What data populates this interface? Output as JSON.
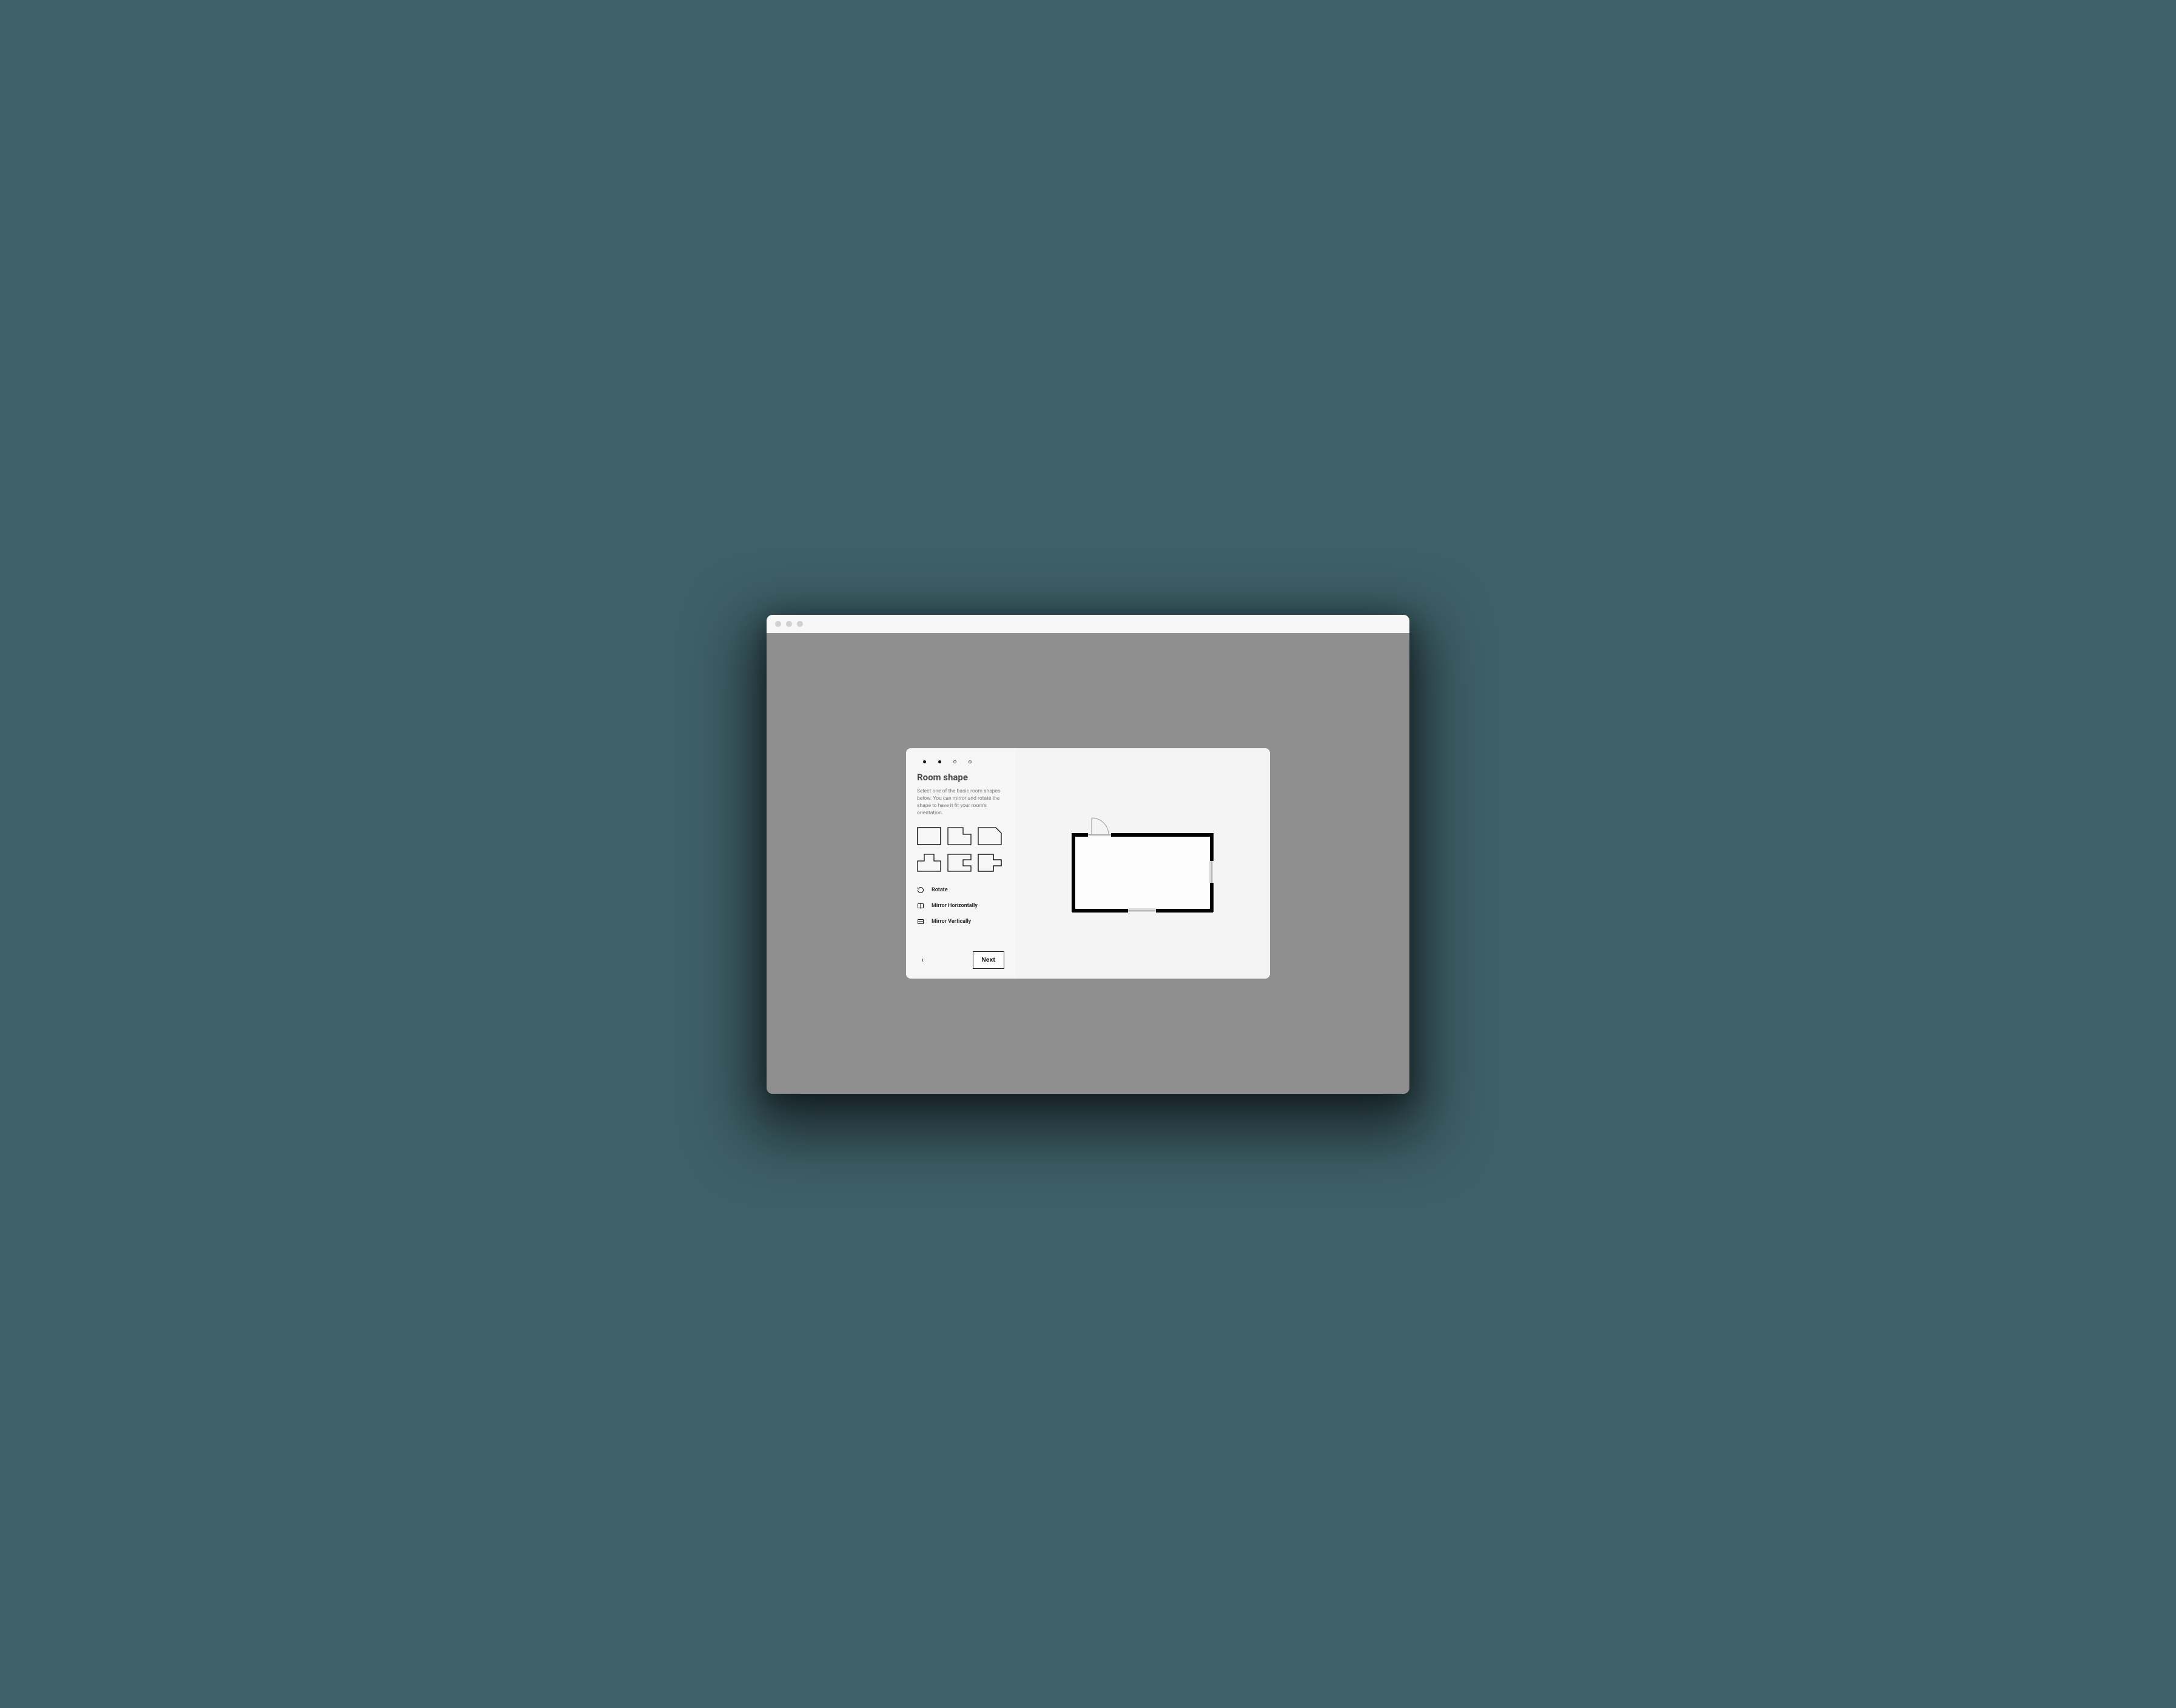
{
  "stepper": {
    "total": 4,
    "current": 2
  },
  "panel": {
    "title": "Room shape",
    "description": "Select one of the basic room shapes below. You can mirror and rotate the shape to have it fit your room's orientation."
  },
  "shapes": [
    {
      "id": "rectangle",
      "selected": true
    },
    {
      "id": "l-shape",
      "selected": false
    },
    {
      "id": "cut-corner",
      "selected": false
    },
    {
      "id": "t-shape",
      "selected": false
    },
    {
      "id": "c-shape",
      "selected": false
    },
    {
      "id": "cross-shape",
      "selected": false
    }
  ],
  "actions": {
    "rotate": "Rotate",
    "mirror_h": "Mirror Horizontally",
    "mirror_v": "Mirror Vertically"
  },
  "footer": {
    "back_glyph": "‹",
    "next_label": "Next"
  },
  "colors": {
    "page_bg": "#3e6068",
    "viewport_bg": "#8f8f8f",
    "modal_bg": "#f6f6f6",
    "text_primary": "#222222",
    "text_muted": "#7a7a7a",
    "stroke": "#111111"
  }
}
